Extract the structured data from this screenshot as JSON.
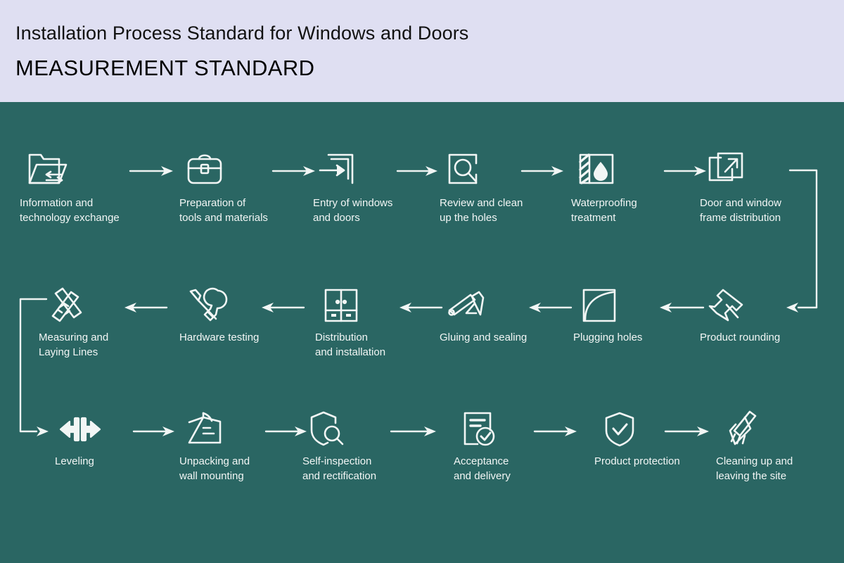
{
  "header": {
    "title": "Installation Process Standard for Windows and Doors",
    "subtitle": "MEASUREMENT STANDARD"
  },
  "colors": {
    "header_background": "#dfdff2",
    "stage_background": "#2a6663",
    "stroke": "#f2f6f5",
    "title_text": "#111111",
    "label_text": "#f2f6f5"
  },
  "flow": {
    "rows": [
      {
        "direction": "left-to-right",
        "steps": [
          {
            "id": "information-and-technology-exchange",
            "icon": "folder-exchange-icon",
            "label": "Information and\ntechnology exchange"
          },
          {
            "id": "preparation-of-tools-and-materials",
            "icon": "toolbox-icon",
            "label": "Preparation of\ntools and materials"
          },
          {
            "id": "entry-of-windows-and-doors",
            "icon": "entry-bracket-arrow-icon",
            "label": "Entry of windows\nand doors"
          },
          {
            "id": "review-and-clean-up-the-holes",
            "icon": "square-magnifier-icon",
            "label": "Review and clean\nup the holes"
          },
          {
            "id": "waterproofing-treatment",
            "icon": "waterdrop-hatch-icon",
            "label": "Waterproofing\ntreatment"
          },
          {
            "id": "door-and-window-frame-distribution",
            "icon": "overlapping-squares-arrow-icon",
            "label": "Door and window\nframe distribution"
          }
        ]
      },
      {
        "direction": "right-to-left",
        "steps": [
          {
            "id": "measuring-and-laying-lines",
            "icon": "crossed-rulers-icon",
            "label": "Measuring and\nLaying Lines"
          },
          {
            "id": "hardware-testing",
            "icon": "wrench-screwdriver-icon",
            "label": "Hardware testing"
          },
          {
            "id": "distribution-and-installation",
            "icon": "window-grid-icon",
            "label": "Distribution\nand installation"
          },
          {
            "id": "gluing-and-sealing",
            "icon": "glue-gun-icon",
            "label": "Gluing and sealing"
          },
          {
            "id": "plugging-holes",
            "icon": "square-curve-fill-icon",
            "label": "Plugging holes"
          },
          {
            "id": "product-rounding",
            "icon": "pushpin-icon",
            "label": "Product rounding"
          }
        ]
      },
      {
        "direction": "left-to-right",
        "steps": [
          {
            "id": "leveling",
            "icon": "width-measure-arrows-icon",
            "label": "Leveling"
          },
          {
            "id": "unpacking-and-wall-mounting",
            "icon": "wall-plaque-icon",
            "label": "Unpacking and\nwall mounting"
          },
          {
            "id": "self-inspection-and-rectification",
            "icon": "shield-magnifier-icon",
            "label": "Self-inspection\nand rectification"
          },
          {
            "id": "acceptance-and-delivery",
            "icon": "document-check-icon",
            "label": "Acceptance\nand delivery"
          },
          {
            "id": "product-protection",
            "icon": "shield-check-icon",
            "label": "Product protection"
          },
          {
            "id": "cleaning-up-and-leaving-the-site",
            "icon": "brush-icon",
            "label": "Cleaning up and\nleaving the site"
          }
        ]
      }
    ],
    "connectors": [
      {
        "id": "row1-to-row2-connector",
        "shape": "right-wrap"
      },
      {
        "id": "row2-to-row3-connector",
        "shape": "left-wrap"
      }
    ]
  }
}
